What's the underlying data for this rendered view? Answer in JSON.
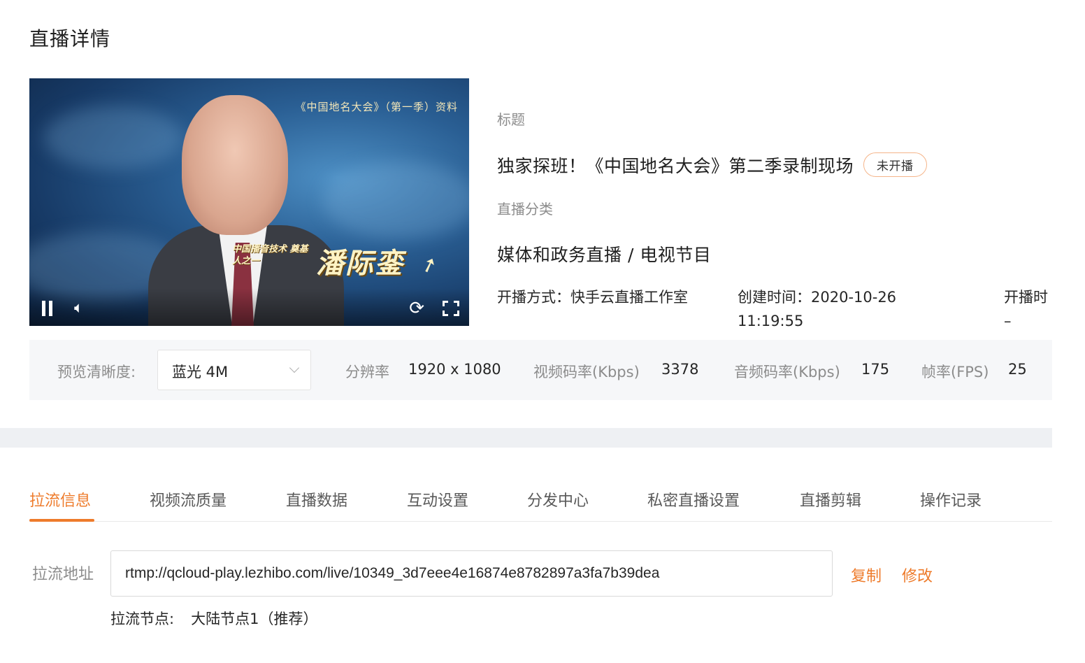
{
  "page": {
    "title": "直播详情"
  },
  "player": {
    "overlay_top": "《中国地名大会》（第一季）资料",
    "overlay_sub": "中国播音技术 奠基人之一",
    "overlay_name": "潘际銮"
  },
  "info": {
    "title_label": "标题",
    "title": "独家探班！《中国地名大会》第二季录制现场",
    "status": "未开播",
    "category_label": "直播分类",
    "category": "媒体和政务直播 / 电视节目",
    "method_label": "开播方式：",
    "method": "快手云直播工作室",
    "created_label": "创建时间：",
    "created": "2020-10-26 11:19:55",
    "start_label": "开播时",
    "start": "–"
  },
  "preview": {
    "quality_label": "预览清晰度:",
    "quality_value": "蓝光 4M",
    "resolution_label": "分辨率",
    "resolution": "1920 x 1080",
    "video_bitrate_label": "视频码率(Kbps)",
    "video_bitrate": "3378",
    "audio_bitrate_label": "音频码率(Kbps)",
    "audio_bitrate": "175",
    "fps_label": "帧率(FPS)",
    "fps": "25"
  },
  "tabs": [
    {
      "label": "拉流信息",
      "active": true
    },
    {
      "label": "视频流质量"
    },
    {
      "label": "直播数据"
    },
    {
      "label": "互动设置"
    },
    {
      "label": "分发中心"
    },
    {
      "label": "私密直播设置"
    },
    {
      "label": "直播剪辑"
    },
    {
      "label": "操作记录"
    }
  ],
  "pull": {
    "label": "拉流地址",
    "url": "rtmp://qcloud-play.lezhibo.com/live/10349_3d7eee4e16874e8782897a3fa7b39dea",
    "copy": "复制",
    "edit": "修改",
    "node_label": "拉流节点:",
    "node_value": "大陆节点1（推荐）"
  },
  "colors": {
    "accent": "#ee7b2b",
    "muted": "#8c8c8c",
    "panel": "#f6f7f9"
  }
}
